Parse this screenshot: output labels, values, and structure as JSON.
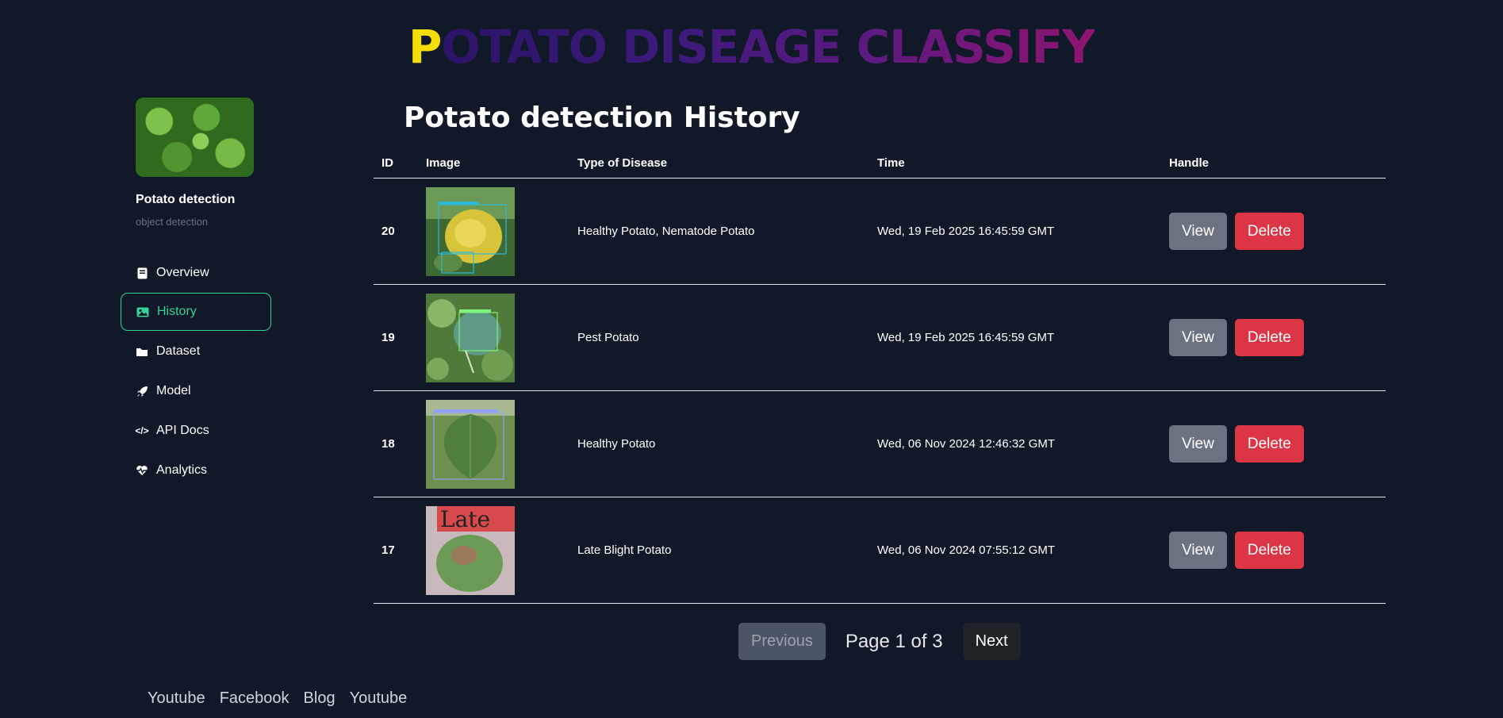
{
  "banner": {
    "first": "P",
    "rest": "OTATO DISEAGE CLASSIFY"
  },
  "sidebar": {
    "title": "Potato detection",
    "subtitle": "object detection",
    "items": [
      {
        "label": "Overview",
        "icon": "book-icon"
      },
      {
        "label": "History",
        "icon": "image-icon",
        "active": true
      },
      {
        "label": "Dataset",
        "icon": "folder-icon"
      },
      {
        "label": "Model",
        "icon": "rocket-icon"
      },
      {
        "label": "API Docs",
        "icon": "code-icon"
      },
      {
        "label": "Analytics",
        "icon": "heart-pulse-icon"
      }
    ]
  },
  "main": {
    "title": "Potato detection History",
    "columns": [
      "ID",
      "Image",
      "Type of Disease",
      "Time",
      "Handle"
    ],
    "rows": [
      {
        "id": "20",
        "disease": "Healthy Potato, Nematode Potato",
        "time": "Wed, 19 Feb 2025 16:45:59 GMT",
        "thumb": "yellow-leaf"
      },
      {
        "id": "19",
        "disease": "Pest Potato",
        "time": "Wed, 19 Feb 2025 16:45:59 GMT",
        "thumb": "pest-leaf"
      },
      {
        "id": "18",
        "disease": "Healthy Potato",
        "time": "Wed, 06 Nov 2024 12:46:32 GMT",
        "thumb": "healthy-leaf"
      },
      {
        "id": "17",
        "disease": "Late Blight Potato",
        "time": "Wed, 06 Nov 2024 07:55:12 GMT",
        "thumb": "late-blight-leaf",
        "thumb_label": "Late"
      }
    ],
    "view_label": "View",
    "delete_label": "Delete"
  },
  "pagination": {
    "previous": "Previous",
    "info": "Page 1 of 3",
    "next": "Next"
  },
  "footer": {
    "links": [
      "Youtube",
      "Facebook",
      "Blog",
      "Youtube"
    ]
  },
  "colors": {
    "background": "#111827",
    "active": "#34d399",
    "delete": "#dc3545",
    "view": "#6b7280"
  }
}
